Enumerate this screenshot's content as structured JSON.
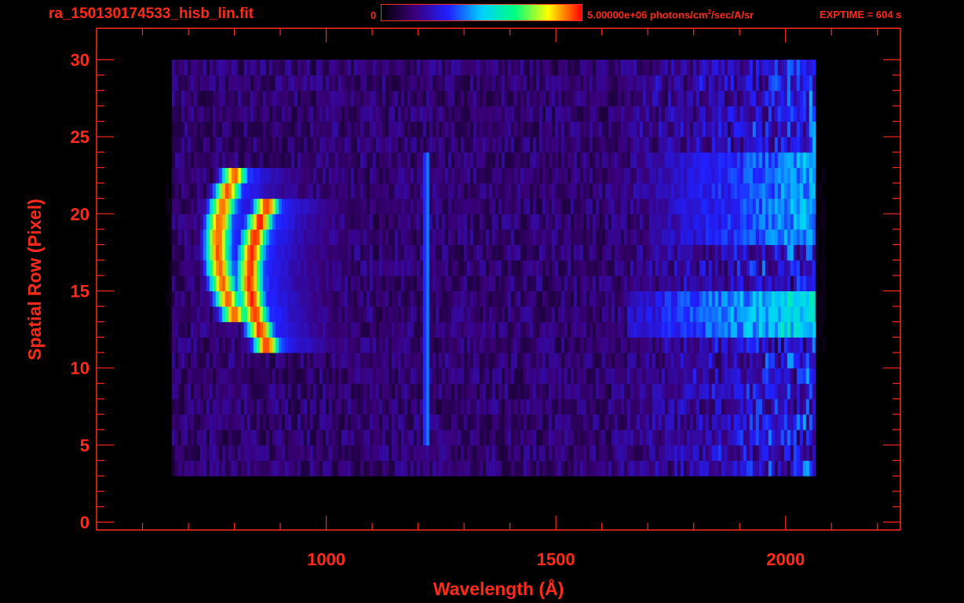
{
  "header": {
    "file_title": "ra_150130174533_hisb_lin.fit",
    "colorbar_min": "0",
    "colorbar_max_value": "5.00000e+06",
    "colorbar_max_unit_prefix": "photons/cm",
    "colorbar_max_unit_exp": "2",
    "colorbar_max_unit_suffix": "/sec/A/sr",
    "exptime": "EXPTIME = 604 s"
  },
  "colors": {
    "axis": "#ff2a1a",
    "background": "#000000",
    "colormap": [
      "#000000",
      "#3a007a",
      "#2020ff",
      "#00d0ff",
      "#00ff80",
      "#ffff00",
      "#ff0000"
    ]
  },
  "chart_data": {
    "type": "heatmap",
    "title": "",
    "xlabel": "Wavelength (Å)",
    "ylabel": "Spatial Row (Pixel)",
    "xlim": [
      500,
      2250
    ],
    "ylim": [
      0,
      30
    ],
    "x_ticks": [
      1000,
      1500,
      2000
    ],
    "y_ticks": [
      0,
      5,
      10,
      15,
      20,
      25,
      30
    ],
    "x_minor_step": 100,
    "y_minor_step": 1,
    "colorscale": "rainbow",
    "zlim": [
      0,
      5000000
    ],
    "signal_wavelength_range": [
      660,
      2060
    ],
    "noise_rows_range": [
      3,
      30
    ],
    "features": [
      {
        "kind": "arc",
        "x_center": 760,
        "rows": [
          13,
          23
        ],
        "peak": 0.92
      },
      {
        "kind": "arc",
        "x_center": 830,
        "rows": [
          11,
          21
        ],
        "peak": 0.95
      },
      {
        "kind": "line",
        "x": 1215,
        "rows": [
          5,
          24
        ],
        "peak": 0.45
      },
      {
        "kind": "band",
        "x_range": [
          1650,
          2060
        ],
        "rows": [
          12,
          15
        ],
        "peak": 0.6
      },
      {
        "kind": "band",
        "x_range": [
          1700,
          2060
        ],
        "rows": [
          18,
          24
        ],
        "peak": 0.5
      }
    ]
  }
}
